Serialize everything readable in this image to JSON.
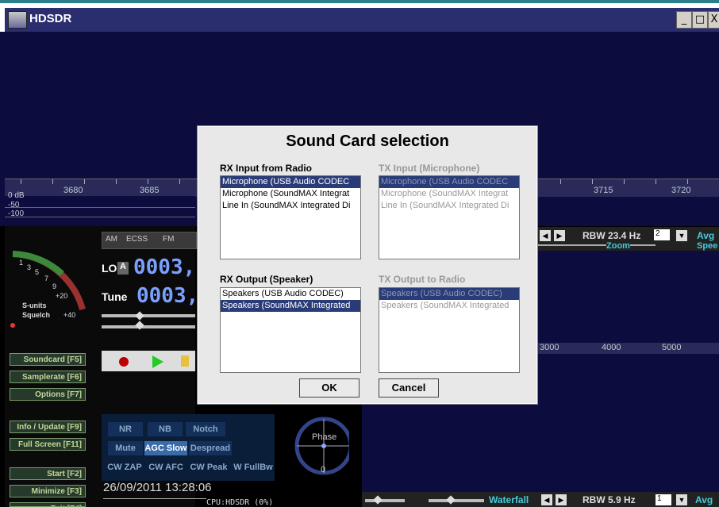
{
  "window": {
    "title": "HDSDR",
    "min_label": "_",
    "max_label": "□",
    "close_label": "X"
  },
  "spectrum": {
    "freq_labels": [
      "3680",
      "3685",
      "3715",
      "3720"
    ],
    "db_labels": [
      "0 dB",
      "-50",
      "-100"
    ]
  },
  "smeter": {
    "scale_labels": [
      "1",
      "3",
      "5",
      "7",
      "9",
      "+20",
      "+40"
    ],
    "label1": "S-units",
    "label2": "Squelch"
  },
  "modes": [
    "AM",
    "ECSS",
    "FM"
  ],
  "lo": {
    "label": "LO",
    "a": "A",
    "digits": "0003,"
  },
  "tune": {
    "label": "Tune",
    "digits": "0003,"
  },
  "left_buttons": [
    {
      "label": "Soundcard  [F5]"
    },
    {
      "label": "Samplerate [F6]"
    },
    {
      "label": "Options   [F7]"
    },
    {
      "label": "Info / Update  [F9]"
    },
    {
      "label": "Full Screen [F11]"
    },
    {
      "label": "Start    [F2]"
    },
    {
      "label": "Minimize [F3]"
    },
    {
      "label": "Exit    [F4]"
    }
  ],
  "dsp": {
    "nr": "NR",
    "nb": "NB",
    "notch": "Notch",
    "mute": "Mute",
    "agc": "AGC Slow",
    "despread": "Despread",
    "cwzap": "CW ZAP",
    "cwafc": "CW AFC",
    "cwpeak": "CW Peak",
    "wfullbw": "W FullBw"
  },
  "phase": {
    "label": "Phase",
    "value": "0"
  },
  "status": {
    "datetime": "26/09/2011 13:28:06",
    "cpu": "CPU:HDSDR  (0%)"
  },
  "rbw_upper": {
    "rbw": "RBW 23.4 Hz",
    "avg_value": "2",
    "avg_label": "Avg",
    "zoom": "Zoom",
    "speed": "Spee"
  },
  "lower_scale": [
    "3000",
    "4000",
    "5000"
  ],
  "rbw_lower": {
    "waterfall": "Waterfall",
    "rbw": "RBW  5.9 Hz",
    "avg_value": "1",
    "avg_label": "Avg"
  },
  "dialog": {
    "title": "Sound Card selection",
    "rx_input": {
      "label": "RX Input from Radio",
      "items": [
        "Microphone (USB Audio CODEC",
        "Microphone (SoundMAX Integrat",
        "Line In (SoundMAX Integrated Di"
      ],
      "selected": 0
    },
    "tx_input": {
      "label": "TX Input (Microphone)",
      "items": [
        "Microphone (USB Audio CODEC",
        "Microphone (SoundMAX Integrat",
        "Line In (SoundMAX Integrated Di"
      ],
      "selected": 0
    },
    "rx_output": {
      "label": "RX Output (Speaker)",
      "items": [
        "Speakers (USB Audio CODEC)",
        "Speakers (SoundMAX Integrated"
      ],
      "selected": 1
    },
    "tx_output": {
      "label": "TX Output to Radio",
      "items": [
        "Speakers (USB Audio CODEC)",
        "Speakers (SoundMAX Integrated"
      ],
      "selected": 0
    },
    "ok_label": "OK",
    "cancel_label": "Cancel"
  },
  "colors": {
    "spectrum_bg": "#0c0c3e",
    "title_bg": "#2a2e6e",
    "selection": "#2a3c78",
    "digits": "#7aa0ff"
  }
}
